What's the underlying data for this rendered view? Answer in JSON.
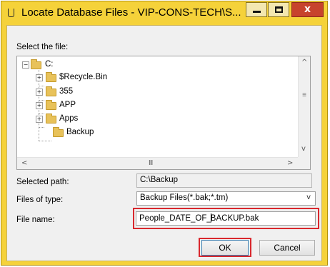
{
  "window": {
    "title": "Locate Database Files - VIP-CONS-TECH\\S...",
    "icons": {
      "app": "database-icon",
      "minimize": "minimize-icon",
      "maximize": "maximize-icon",
      "close": "close-icon"
    },
    "close_glyph": "x"
  },
  "select_label": "Select the file:",
  "tree": {
    "root": {
      "label": "C:",
      "expander": "−"
    },
    "children": [
      {
        "label": "$Recycle.Bin",
        "expander": "+"
      },
      {
        "label": "355",
        "expander": "+"
      },
      {
        "label": "APP",
        "expander": "+"
      },
      {
        "label": "Apps",
        "expander": "+"
      },
      {
        "label": "Backup",
        "expander": ""
      }
    ]
  },
  "scrollbar": {
    "up": "^",
    "down": "v",
    "left": "<",
    "right": ">",
    "hthumb": "III",
    "vthumb": "≡"
  },
  "selected_path": {
    "label": "Selected path:",
    "value": "C:\\Backup"
  },
  "files_of_type": {
    "label": "Files of type:",
    "value": "Backup Files(*.bak;*.tm)"
  },
  "file_name": {
    "label": "File name:",
    "value_before_caret": "People_DATE_OF_",
    "value_after_caret": "BACKUP.bak"
  },
  "buttons": {
    "ok": "OK",
    "cancel": "Cancel"
  },
  "colors": {
    "frame": "#f5d23a",
    "close": "#c7432d",
    "highlight": "#d9282e",
    "folder": "#e8c25a"
  }
}
